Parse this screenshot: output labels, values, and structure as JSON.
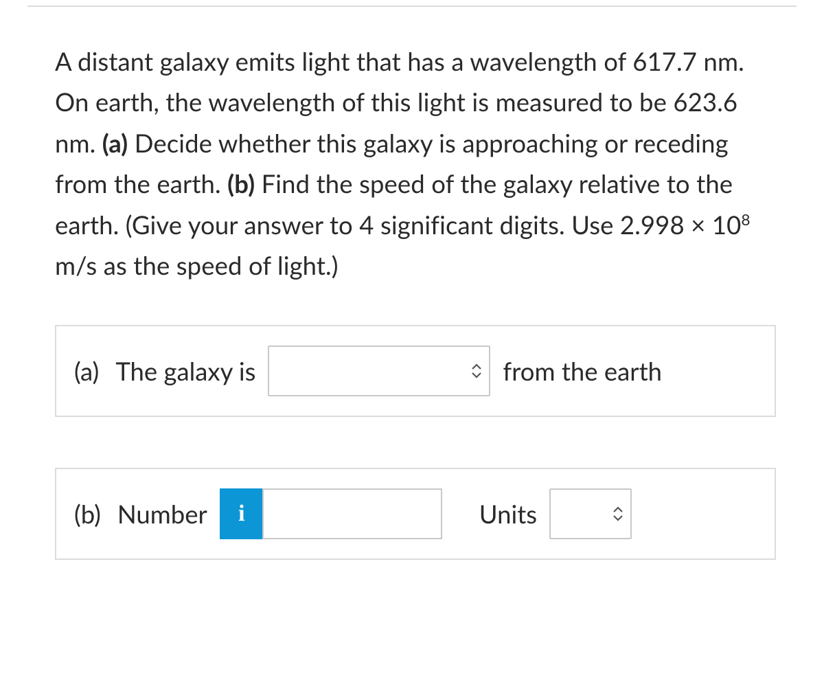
{
  "question": {
    "text_parts": [
      "A distant galaxy emits light that has a wavelength of 617.7 nm. On earth, the wavelength of this light is measured to be 623.6 nm. ",
      "(a)",
      " Decide whether this galaxy is approaching or receding from the earth. ",
      "(b)",
      " Find the speed of the galaxy relative to the earth. (Give your answer to 4 significant digits. Use 2.998 × 10",
      "8",
      " m/s as the speed of light.)"
    ]
  },
  "part_a": {
    "letter": "(a)",
    "prefix": "The galaxy is",
    "select_value": "",
    "suffix": "from the earth"
  },
  "part_b": {
    "letter": "(b)",
    "prefix": "Number",
    "info_icon_label": "i",
    "number_value": "",
    "units_label": "Units",
    "units_value": ""
  }
}
